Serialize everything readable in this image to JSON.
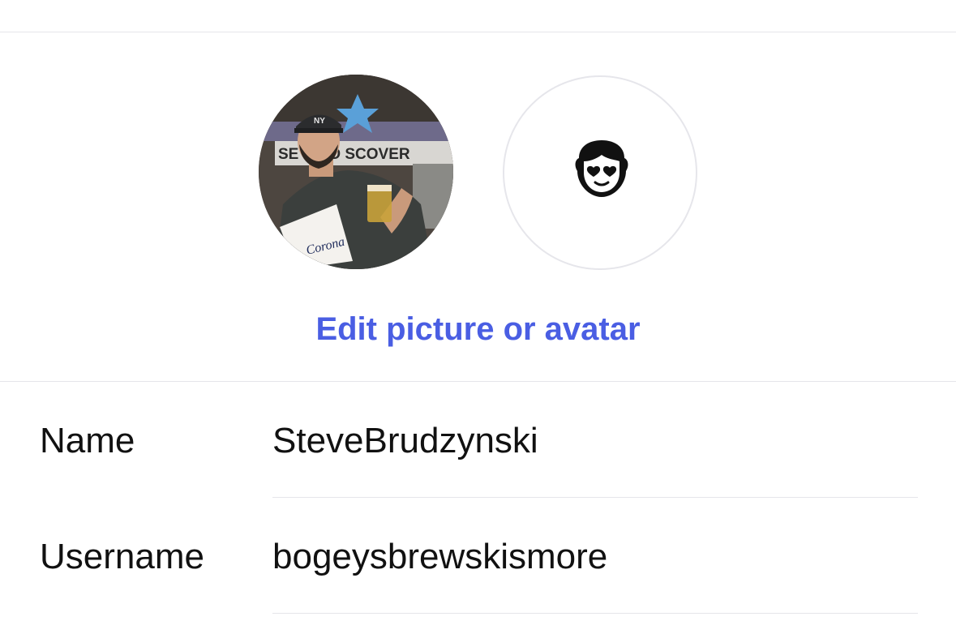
{
  "header": {
    "profile_photo": "profile-photo",
    "emoji_avatar_icon": "face-with-heart-eyes-icon"
  },
  "edit_link": {
    "label": "Edit picture or avatar",
    "color": "#4a5ee3"
  },
  "fields": [
    {
      "label": "Name",
      "value": "SteveBrudzynski"
    },
    {
      "label": "Username",
      "value": "bogeysbrewskismore"
    }
  ]
}
